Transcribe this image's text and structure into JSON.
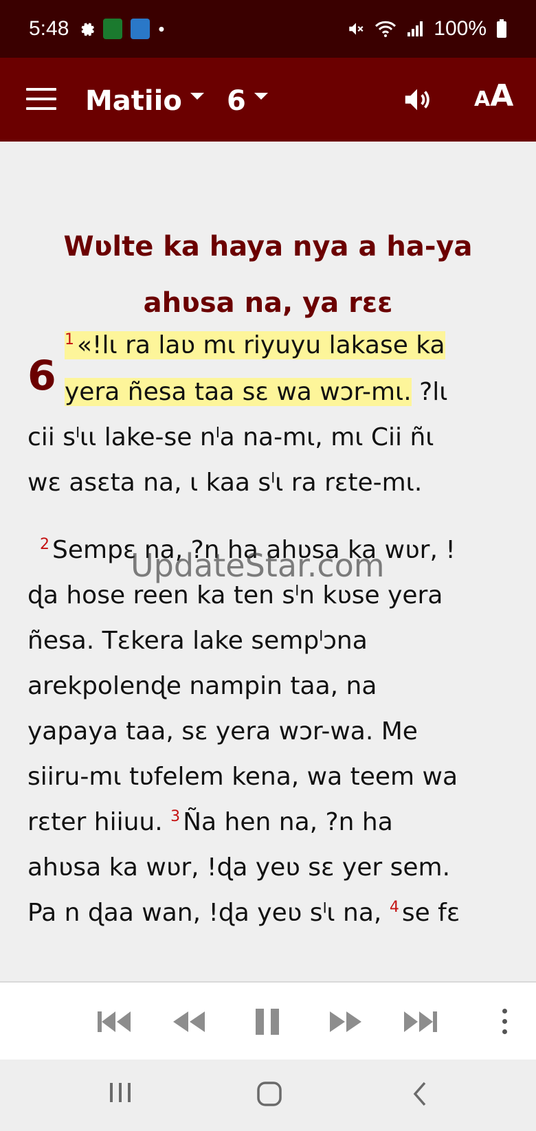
{
  "status_bar": {
    "time": "5:48",
    "battery": "100%",
    "icons": [
      "settings-icon",
      "app-icon-green",
      "app-icon-blue",
      "dot-icon",
      "mute-icon",
      "wifi-icon",
      "signal-icon",
      "battery-icon"
    ]
  },
  "app_bar": {
    "book": "Matiio",
    "chapter": "6",
    "icons": [
      "menu-icon",
      "dropdown-caret-icon",
      "volume-icon",
      "text-size-icon"
    ],
    "text_size_label": "AA",
    "colors": {
      "app_bar": "#6b0000",
      "status_bar": "#3a0000"
    }
  },
  "reader": {
    "section_title_line1": "Wʋlte ka haya nya a ha-ya",
    "section_title_line2": "ahʋsa na, ya rɛɛ",
    "chapter_number": "6",
    "lines": [
      {
        "verse": "1",
        "text": "«!lɩ ra laʋ mɩ riyuyu lakase ka"
      },
      {
        "text_highlight": "yera ñesa taa sɛ wa wɔr-mɩ.",
        "text": " ?lɩ"
      },
      {
        "text": "cii sˡɩɩ lake-se nˡa na-mɩ, mɩ Cii ñɩ"
      },
      {
        "text": "wɛ asɛta na, ɩ kaa sˡɩ ra rɛte-mɩ."
      },
      {
        "verse": "2",
        "text": "Sempɛ na, ?n ha ahʋsa ka wʋr, !"
      },
      {
        "text": "ɖa hose reen ka ten sˡn kʋse yera"
      },
      {
        "text": "ñesa. Tɛkera lake sempˡɔna"
      },
      {
        "text": "arekpolenɖe nampin taa, na"
      },
      {
        "text": "yapaya taa, sɛ yera wɔr-wa. Me"
      },
      {
        "text": "siiru-mɩ tʋfelem kena, wa teem wa"
      },
      {
        "text": "rɛter hiiuu.",
        "verse_inline": "3",
        "text_after": "Ña hen na, ?n ha"
      },
      {
        "text": "ahʋsa ka wʋr, !ɖa yeʋ sɛ yer sem."
      },
      {
        "text": "Pa n ɖaa wan, !ɖa yeʋ sˡɩ na,",
        "verse_inline": "4",
        "text_after": "se fɛ"
      }
    ],
    "watermark": "UpdateStar.com",
    "highlight_color": "#fdf59a"
  },
  "player": {
    "controls": [
      "skip-previous-icon",
      "rewind-icon",
      "pause-icon",
      "fast-forward-icon",
      "skip-next-icon",
      "more-options-icon"
    ]
  },
  "nav": {
    "buttons": [
      "recent-apps-icon",
      "home-icon",
      "back-icon"
    ]
  }
}
